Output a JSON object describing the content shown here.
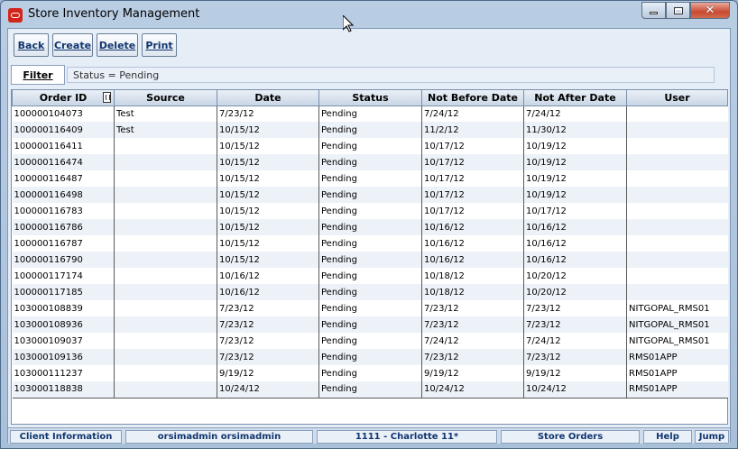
{
  "window": {
    "title": "Store Inventory Management",
    "controls": {
      "minimize": "minimize",
      "maximize": "maximize",
      "close": "close"
    }
  },
  "toolbar": {
    "back_label": "Back",
    "create_label": "Create",
    "delete_label": "Delete",
    "print_label": "Print"
  },
  "filter": {
    "button_label": "Filter",
    "status_text": "Status = Pending"
  },
  "table": {
    "columns": [
      "Order ID",
      "Source",
      "Date",
      "Status",
      "Not Before Date",
      "Not After Date",
      "User"
    ],
    "rows": [
      [
        "100000104073",
        "Test",
        "7/23/12",
        "Pending",
        "7/24/12",
        "7/24/12",
        ""
      ],
      [
        "100000116409",
        "Test",
        "10/15/12",
        "Pending",
        "11/2/12",
        "11/30/12",
        ""
      ],
      [
        "100000116411",
        "",
        "10/15/12",
        "Pending",
        "10/17/12",
        "10/19/12",
        ""
      ],
      [
        "100000116474",
        "",
        "10/15/12",
        "Pending",
        "10/17/12",
        "10/19/12",
        ""
      ],
      [
        "100000116487",
        "",
        "10/15/12",
        "Pending",
        "10/17/12",
        "10/19/12",
        ""
      ],
      [
        "100000116498",
        "",
        "10/15/12",
        "Pending",
        "10/17/12",
        "10/19/12",
        ""
      ],
      [
        "100000116783",
        "",
        "10/15/12",
        "Pending",
        "10/17/12",
        "10/17/12",
        ""
      ],
      [
        "100000116786",
        "",
        "10/15/12",
        "Pending",
        "10/16/12",
        "10/16/12",
        ""
      ],
      [
        "100000116787",
        "",
        "10/15/12",
        "Pending",
        "10/16/12",
        "10/16/12",
        ""
      ],
      [
        "100000116790",
        "",
        "10/15/12",
        "Pending",
        "10/16/12",
        "10/16/12",
        ""
      ],
      [
        "100000117174",
        "",
        "10/16/12",
        "Pending",
        "10/18/12",
        "10/20/12",
        ""
      ],
      [
        "100000117185",
        "",
        "10/16/12",
        "Pending",
        "10/18/12",
        "10/20/12",
        ""
      ],
      [
        "103000108839",
        "",
        "7/23/12",
        "Pending",
        "7/23/12",
        "7/23/12",
        "NITGOPAL_RMS01"
      ],
      [
        "103000108936",
        "",
        "7/23/12",
        "Pending",
        "7/23/12",
        "7/23/12",
        "NITGOPAL_RMS01"
      ],
      [
        "103000109037",
        "",
        "7/23/12",
        "Pending",
        "7/24/12",
        "7/24/12",
        "NITGOPAL_RMS01"
      ],
      [
        "103000109136",
        "",
        "7/23/12",
        "Pending",
        "7/23/12",
        "7/23/12",
        "RMS01APP"
      ],
      [
        "103000111237",
        "",
        "9/19/12",
        "Pending",
        "9/19/12",
        "9/19/12",
        "RMS01APP"
      ],
      [
        "103000118838",
        "",
        "10/24/12",
        "Pending",
        "10/24/12",
        "10/24/12",
        "RMS01APP"
      ]
    ]
  },
  "statusbar": {
    "client_info": "Client Information",
    "user": "orsimadmin orsimadmin",
    "store": "1111 - Charlotte 11*",
    "module": "Store Orders",
    "help": "Help",
    "jump": "Jump"
  },
  "colors": {
    "title_bar": "#b9cde3",
    "client_bg": "#e5edf6",
    "button_text": "#10356f",
    "row_alt": "#edf2f8",
    "close_button": "#c94a32"
  }
}
